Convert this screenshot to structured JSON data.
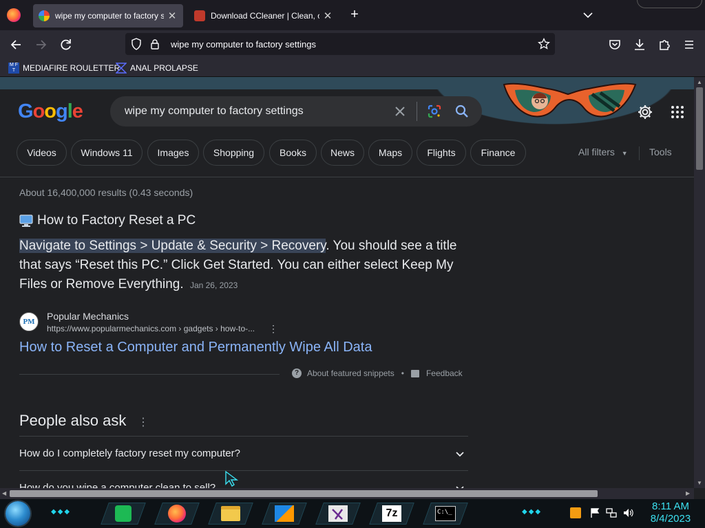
{
  "browser": {
    "tabs": [
      {
        "title": "wipe my computer to factory settings - Google Search",
        "active": true
      },
      {
        "title": "Download CCleaner | Clean, optimize & tune up your PC",
        "active": false
      }
    ],
    "url": "wipe my computer to factory settings",
    "bookmarks": [
      "MEDIAFIRE ROULETTER",
      "ANAL PROLAPSE"
    ]
  },
  "search": {
    "logo": "Google",
    "query": "wipe my computer to factory settings",
    "chips": [
      "Videos",
      "Windows 11",
      "Images",
      "Shopping",
      "Books",
      "News",
      "Maps",
      "Flights",
      "Finance"
    ],
    "all_filters": "All filters",
    "tools": "Tools",
    "stats": "About 16,400,000 results (0.43 seconds)"
  },
  "featured": {
    "heading": "How to Factory Reset a PC",
    "highlight": "Navigate to Settings > Update & Security > Recovery",
    "body_rest": ". You should see a title that says “Reset this PC.” Click Get Started. You can either select Keep My Files or Remove Everything.",
    "date": "Jan 26, 2023",
    "source_name": "Popular Mechanics",
    "source_icon_text": "PM",
    "source_url": "https://www.popularmechanics.com › gadgets › how-to-...",
    "link": "How to Reset a Computer and Permanently Wipe All Data",
    "about": "About featured snippets",
    "feedback": "Feedback"
  },
  "paa": {
    "title": "People also ask",
    "questions": [
      "How do I completely factory reset my computer?",
      "How do you wipe a computer clean to sell?"
    ]
  },
  "taskbar": {
    "time": "8:11 AM",
    "date": "8/4/2023",
    "sevenzip_label": "7z"
  },
  "colors": {
    "link": "#8ab4f8",
    "highlight": "#394457",
    "clock": "#3ce0f0"
  }
}
